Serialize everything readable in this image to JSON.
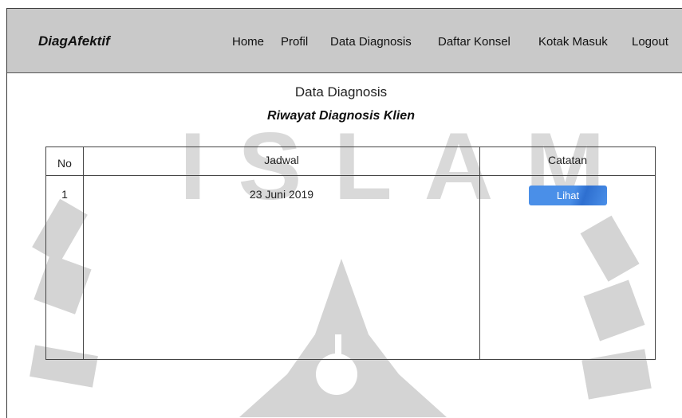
{
  "navbar": {
    "brand": "DiagAfektif",
    "items": [
      {
        "label": "Home"
      },
      {
        "label": "Profil"
      },
      {
        "label": "Data Diagnosis"
      },
      {
        "label": "Daftar Konsel"
      },
      {
        "label": "Kotak Masuk"
      },
      {
        "label": "Logout"
      }
    ]
  },
  "main": {
    "title": "Data Diagnosis",
    "subtitle": "Riwayat Diagnosis Klien"
  },
  "table": {
    "headers": [
      "No",
      "Jadwal",
      "Catatan"
    ],
    "rows": [
      {
        "no": "1",
        "jadwal": "23 Juni 2019",
        "action_label": "Lihat"
      }
    ]
  },
  "watermark": {
    "text": "ISLAM",
    "color": "#d4d4d4"
  },
  "colors": {
    "navbar_bg": "#c9c9c9",
    "button_bg": "#4a8fe8"
  }
}
